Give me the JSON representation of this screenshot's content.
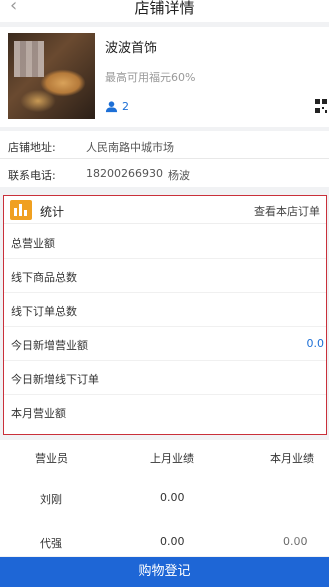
{
  "nav": {
    "title": "店铺详情"
  },
  "shop": {
    "name": "波波首饰",
    "subtitle": "最高可用福元60%",
    "user_count": "2"
  },
  "info": {
    "address_label": "店铺地址:",
    "address_value": "人民南路中城市场",
    "phone_label": "联系电话:",
    "phone_value": "18200266930",
    "contact_name": "杨波"
  },
  "stats": {
    "title": "统计",
    "link": "查看本店订单",
    "rows": [
      {
        "label": "总营业额",
        "value": ""
      },
      {
        "label": "线下商品总数",
        "value": ""
      },
      {
        "label": "线下订单总数",
        "value": ""
      },
      {
        "label": "今日新增营业额",
        "value": "0.0"
      },
      {
        "label": "今日新增线下订单",
        "value": ""
      },
      {
        "label": "本月营业额",
        "value": ""
      }
    ]
  },
  "table": {
    "headers": [
      "营业员",
      "上月业绩",
      "本月业绩"
    ],
    "rows": [
      [
        "刘刚",
        "0.00",
        ""
      ],
      [
        "代强",
        "0.00",
        "0.00"
      ]
    ]
  },
  "footer": {
    "label": "购物登记"
  }
}
